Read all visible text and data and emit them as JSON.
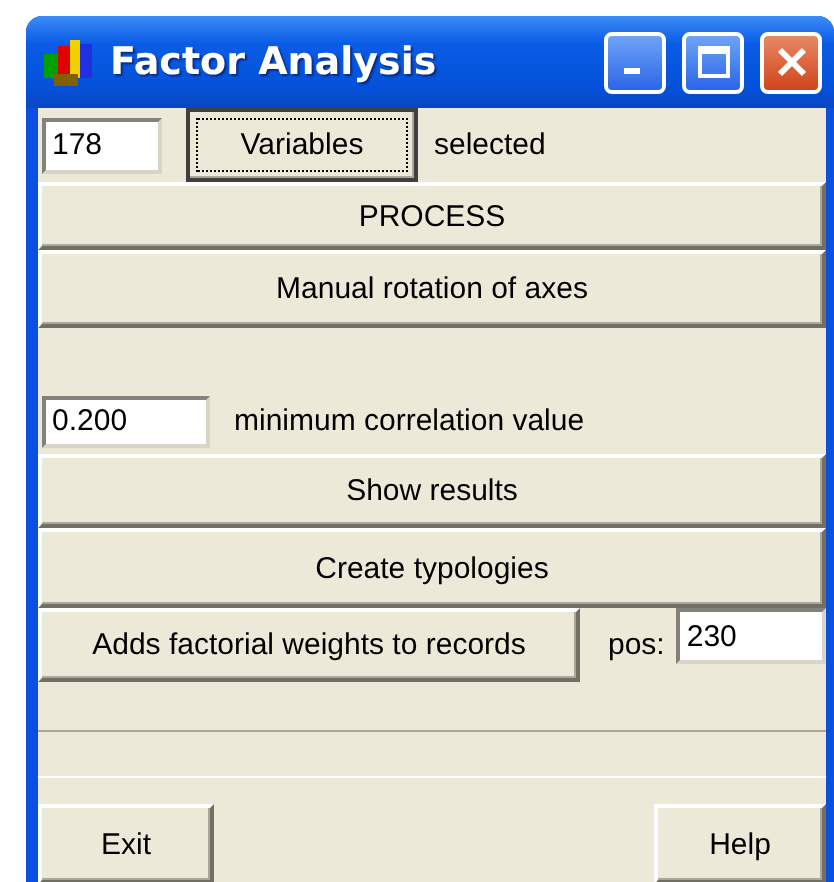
{
  "window": {
    "title": "Factor Analysis"
  },
  "selection": {
    "count": "178",
    "button": "Variables",
    "focused": true,
    "label": "selected"
  },
  "actions": [
    {
      "label": "PROCESS"
    },
    {
      "label": "Manual rotation of axes"
    }
  ],
  "correlation": {
    "value": "0.200",
    "label": "minimum correlation value"
  },
  "results_actions": [
    {
      "label": "Show results"
    },
    {
      "label": "Create typologies"
    }
  ],
  "weights": {
    "button": "Adds factorial weights to records",
    "pos_label": "pos:",
    "pos_value": "230"
  },
  "footer": {
    "exit": "Exit",
    "help": "Help"
  }
}
